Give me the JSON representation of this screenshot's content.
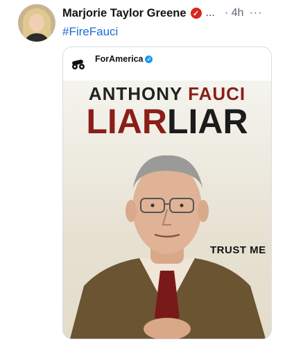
{
  "tweet": {
    "author": "Marjorie Taylor Greene",
    "verified_badge_glyph": "✓",
    "ellipsis": "...",
    "time": "· 4h",
    "more": "···",
    "text": "#FireFauci"
  },
  "quoted": {
    "account": "ForAmerica",
    "verified_badge_glyph": "✓",
    "account_icon": "cannon-icon",
    "poster": {
      "title_first": "ANTHONY ",
      "title_last": "FAUCI",
      "subtitle_a": "LIAR",
      "subtitle_b": "LIAR",
      "caption": "TRUST ME"
    }
  },
  "colors": {
    "link": "#1b6bd6",
    "poster_red": "#8a1e18",
    "badge_red": "#d7261e",
    "verified_blue": "#1d9bf0"
  }
}
